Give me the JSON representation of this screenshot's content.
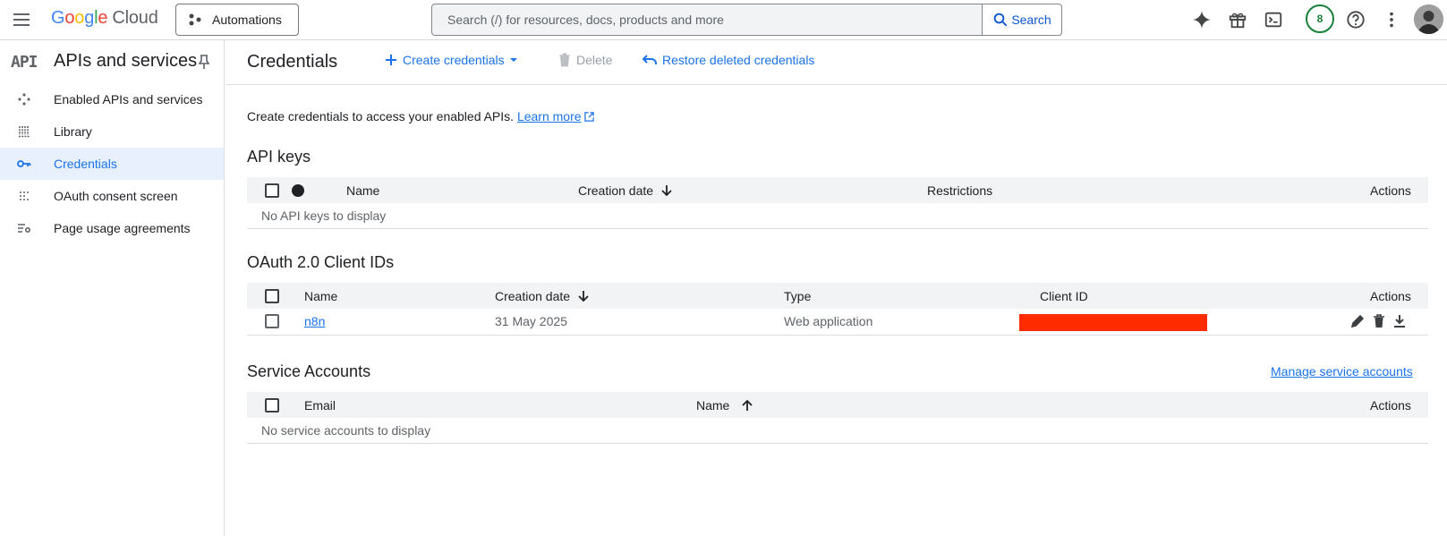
{
  "topbar": {
    "logo_parts": [
      "G",
      "o",
      "o",
      "g",
      "l",
      "e"
    ],
    "logo_cloud": "Cloud",
    "project_label": "Automations",
    "search_placeholder": "Search (/) for resources, docs, products and more",
    "search_button": "Search",
    "notification_count": "8"
  },
  "sidebar": {
    "logo_text": "API",
    "title": "APIs and services",
    "items": [
      {
        "label": "Enabled APIs and services",
        "icon": "enabled-apis-icon"
      },
      {
        "label": "Library",
        "icon": "library-icon"
      },
      {
        "label": "Credentials",
        "icon": "key-icon",
        "active": true
      },
      {
        "label": "OAuth consent screen",
        "icon": "oauth-icon"
      },
      {
        "label": "Page usage agreements",
        "icon": "settings-list-icon"
      }
    ]
  },
  "main": {
    "title": "Credentials",
    "actions": {
      "create": "Create credentials",
      "delete": "Delete",
      "restore": "Restore deleted credentials"
    },
    "intro_text": "Create credentials to access your enabled APIs.",
    "learn_more": "Learn more",
    "api_keys": {
      "title": "API keys",
      "columns": [
        "Name",
        "Creation date",
        "Restrictions",
        "Actions"
      ],
      "empty": "No API keys to display"
    },
    "oauth": {
      "title": "OAuth 2.0 Client IDs",
      "columns": [
        "Name",
        "Creation date",
        "Type",
        "Client ID",
        "Actions"
      ],
      "rows": [
        {
          "name": "n8n",
          "creation_date": "31 May 2025",
          "type": "Web application"
        }
      ]
    },
    "service_accounts": {
      "title": "Service Accounts",
      "manage_link": "Manage service accounts",
      "columns": [
        "Email",
        "Name",
        "Actions"
      ],
      "empty": "No service accounts to display"
    }
  },
  "colors": {
    "accent": "#1a73e8",
    "redaction": "#ff2b00",
    "active_bg": "#e8f0fe"
  }
}
